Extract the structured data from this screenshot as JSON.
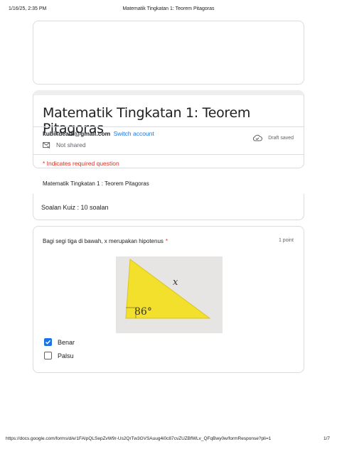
{
  "print_header": {
    "datetime": "1/16/25, 2:35 PM",
    "page_title": "Matematik Tingkatan 1: Teorem Pitagoras"
  },
  "form": {
    "title": "Matematik Tingkatan 1: Teorem Pitagoras",
    "account_email": "kubikdeath@gmail.com",
    "switch_account": "Switch account",
    "not_shared": "Not shared",
    "draft_saved": "Draft saved",
    "required_note": "* Indicates required question"
  },
  "section": {
    "title": "Matematik Tingkatan 1 :  Teorem Pitagoras",
    "description": "Soalan Kuiz : 10 soalan"
  },
  "question": {
    "text": "Bagi segi tiga di bawah, x merupakan hipotenus",
    "required_marker": "*",
    "points": "1 point",
    "figure": {
      "angle_label": "86°",
      "side_label": "x",
      "fill_color": "#f2e02c"
    },
    "options": [
      {
        "label": "Benar",
        "checked": true
      },
      {
        "label": "Palsu",
        "checked": false
      }
    ]
  },
  "footer": {
    "url": "https://docs.google.com/forms/d/e/1FAIpQLSepZvW9r-Us2QrTw3GVSAuug4i0c87cvZUZBfWLv_QFqBwy0w/formResponse?pli=1",
    "page": "1/7"
  },
  "colors": {
    "accent": "#1a73e8",
    "required": "#d93025",
    "border": "#dadce0"
  }
}
